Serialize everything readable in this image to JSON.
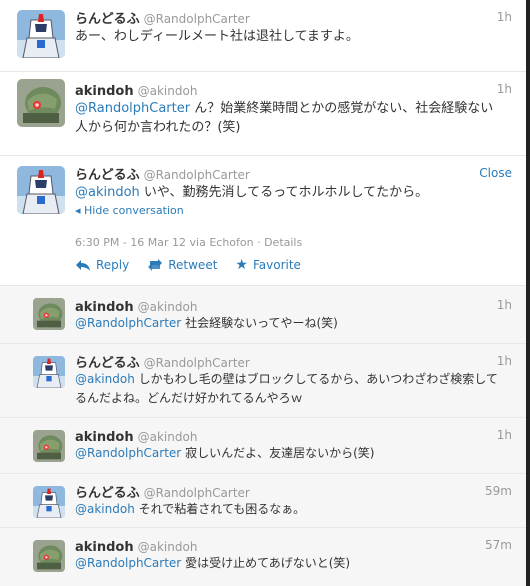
{
  "tweets": [
    {
      "name": "らんどるふ",
      "handle": "@RandolphCarter",
      "time": "1h",
      "mention": "",
      "text": "あー、わしディールメート社は退社してますよ。",
      "avatar": "robot"
    },
    {
      "name": "akindoh",
      "handle": "@akindoh",
      "time": "1h",
      "mention": "@RandolphCarter",
      "text": " ん？始業終業時間とかの感覚がない、社会経験ない人から何か言われたの？(笑)",
      "avatar": "mech"
    },
    {
      "name": "らんどるふ",
      "handle": "@RandolphCarter",
      "close_label": "Close",
      "mention": "@akindoh",
      "text": " いや、勤務先消してるってホルホルしてたから。",
      "hide_conversation": "Hide conversation",
      "meta": "6:30 PM - 16 Mar 12 via Echofon · Details",
      "reply_label": "Reply",
      "retweet_label": "Retweet",
      "favorite_label": "Favorite",
      "avatar": "robot"
    },
    {
      "name": "akindoh",
      "handle": "@akindoh",
      "time": "1h",
      "mention": "@RandolphCarter",
      "text": " 社会経験ないってやーね(笑)",
      "avatar": "mech"
    },
    {
      "name": "らんどるふ",
      "handle": "@RandolphCarter",
      "time": "1h",
      "mention": "@akindoh",
      "text": " しかもわし毛の壁はブロックしてるから、あいつわざわざ検索してるんだよね。どんだけ好かれてるんやろｗ",
      "avatar": "robot"
    },
    {
      "name": "akindoh",
      "handle": "@akindoh",
      "time": "1h",
      "mention": "@RandolphCarter",
      "text": " 寂しいんだよ、友達居ないから(笑)",
      "avatar": "mech"
    },
    {
      "name": "らんどるふ",
      "handle": "@RandolphCarter",
      "time": "59m",
      "mention": "@akindoh",
      "text": " それで粘着されても困るなぁ。",
      "avatar": "robot"
    },
    {
      "name": "akindoh",
      "handle": "@akindoh",
      "time": "57m",
      "mention": "@RandolphCarter",
      "text": " 愛は受け止めてあげないと(笑)",
      "avatar": "mech"
    }
  ],
  "colors": {
    "link": "#2b7bb9",
    "muted": "#999999",
    "text": "#333333",
    "border": "#e8e8e8",
    "conversation_bg": "#f6f6f6"
  }
}
